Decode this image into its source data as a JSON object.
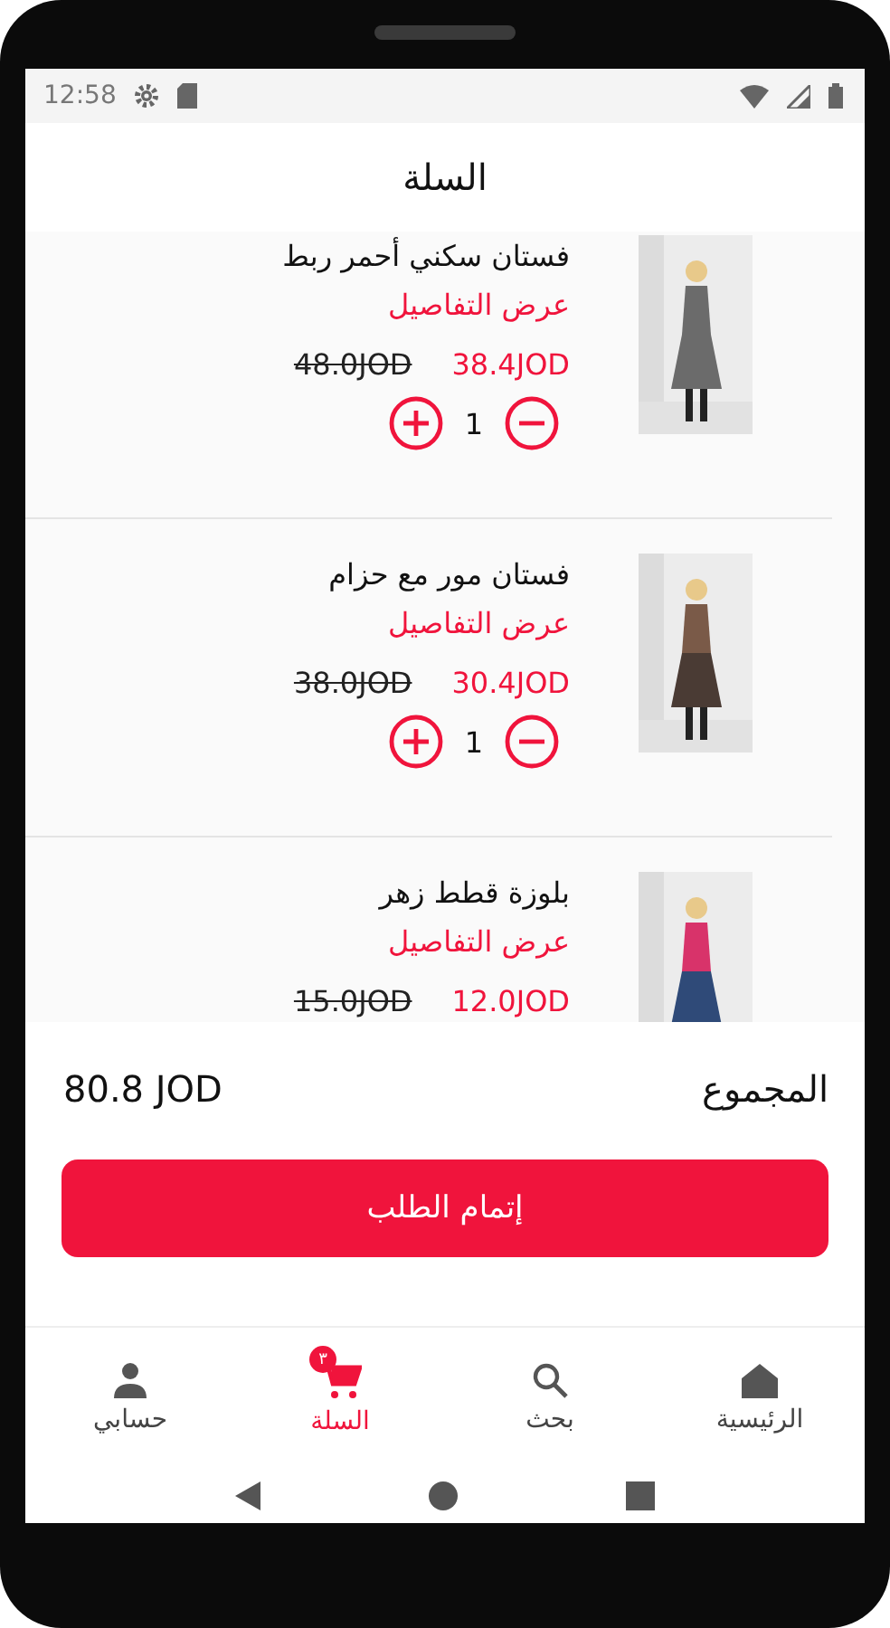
{
  "status_bar": {
    "time": "12:58"
  },
  "header": {
    "title": "السلة"
  },
  "cart_items": [
    {
      "name": "فستان سكني أحمر ربط",
      "details_link": "عرض التفاصيل",
      "old_price": "48.0JOD",
      "price": "38.4JOD",
      "quantity": "1"
    },
    {
      "name": "فستان مور مع حزام",
      "details_link": "عرض التفاصيل",
      "old_price": "38.0JOD",
      "price": "30.4JOD",
      "quantity": "1"
    },
    {
      "name": "بلوزة قطط زهر",
      "details_link": "عرض التفاصيل",
      "old_price": "15.0JOD",
      "price": "12.0JOD"
    }
  ],
  "total": {
    "label": "المجموع",
    "value": "80.8 JOD"
  },
  "checkout_button": "إتمام الطلب",
  "bottom_nav": [
    {
      "label": "الرئيسية",
      "kind": "home",
      "selected": false
    },
    {
      "label": "بحث",
      "kind": "search",
      "selected": false
    },
    {
      "label": "السلة",
      "kind": "cart",
      "selected": true,
      "badge": "٣"
    },
    {
      "label": "حسابي",
      "kind": "person",
      "selected": false
    }
  ]
}
